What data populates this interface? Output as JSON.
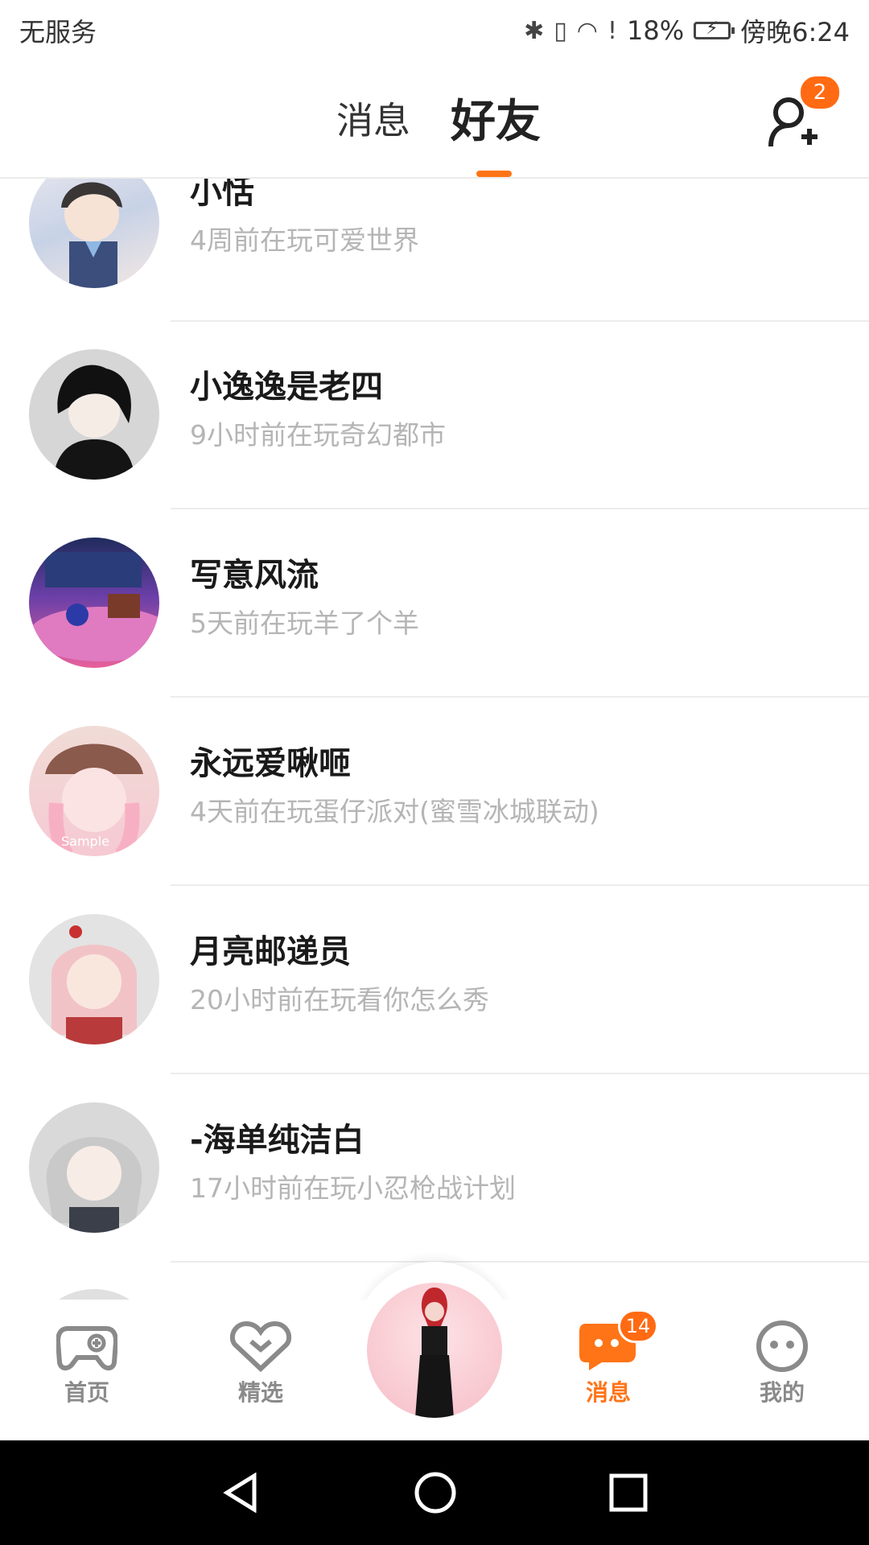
{
  "status_bar": {
    "carrier": "无服务",
    "battery": "18%",
    "time": "傍晚6:24"
  },
  "header": {
    "tabs": [
      {
        "label": "消息",
        "active": false
      },
      {
        "label": "好友",
        "active": true
      }
    ],
    "add_friend_badge": "2",
    "accent_color": "#ff7417"
  },
  "friends": [
    {
      "name": "小恬",
      "status": "4周前在玩可爱世界"
    },
    {
      "name": "小逸逸是老四",
      "status": "9小时前在玩奇幻都市"
    },
    {
      "name": "写意风流",
      "status": "5天前在玩羊了个羊"
    },
    {
      "name": "永远爱啾咂",
      "status": "4天前在玩蛋仔派对(蜜雪冰城联动)"
    },
    {
      "name": "月亮邮递员",
      "status": "20小时前在玩看你怎么秀"
    },
    {
      "name": "-海单纯洁白",
      "status": "17小时前在玩小忍枪战计划"
    }
  ],
  "bottom_nav": {
    "items": [
      {
        "label": "首页",
        "icon": "gamepad-icon"
      },
      {
        "label": "精选",
        "icon": "heart-chevron-icon"
      },
      {
        "label": "消息",
        "icon": "chat-bubble-icon",
        "badge": "14",
        "active": true
      },
      {
        "label": "我的",
        "icon": "face-icon"
      }
    ]
  },
  "avatar_watermark": "Sample"
}
